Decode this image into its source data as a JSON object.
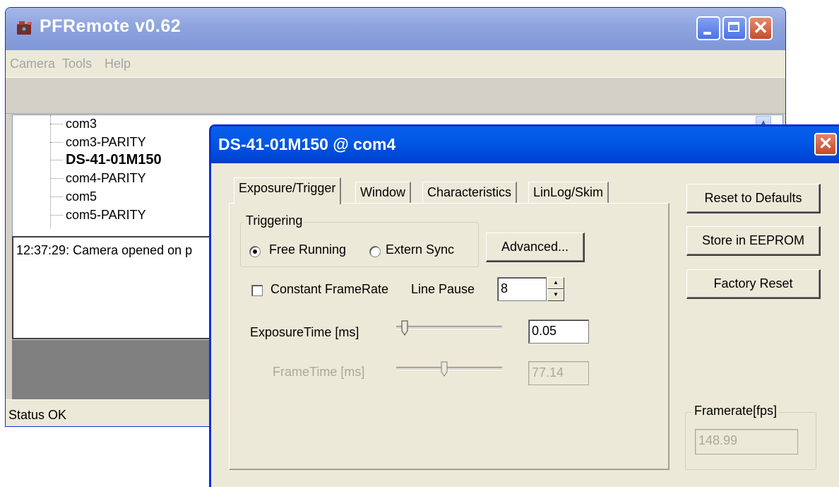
{
  "main_window": {
    "title": "PFRemote v0.62",
    "menu": [
      "Camera",
      "Tools",
      "Help"
    ],
    "tree_items": [
      {
        "label": "com3",
        "selected": false
      },
      {
        "label": "com3-PARITY",
        "selected": false
      },
      {
        "label": "DS-41-01M150",
        "selected": true
      },
      {
        "label": "com4-PARITY",
        "selected": false
      },
      {
        "label": "com5",
        "selected": false
      },
      {
        "label": "com5-PARITY",
        "selected": false
      }
    ],
    "log_line": "12:37:29: Camera opened on p",
    "status": "Status OK"
  },
  "dialog": {
    "title": "DS-41-01M150 @ com4",
    "tabs": [
      "Exposure/Trigger",
      "Window",
      "Characteristics",
      "LinLog/Skim"
    ],
    "active_tab": "Exposure/Trigger",
    "triggering": {
      "legend": "Triggering",
      "options": [
        "Free Running",
        "Extern Sync"
      ],
      "selected": "Free Running",
      "advanced_button": "Advanced..."
    },
    "constant_framerate": {
      "label": "Constant FrameRate",
      "checked": false
    },
    "line_pause": {
      "label": "Line Pause",
      "value": "8"
    },
    "exposure_time": {
      "label": "ExposureTime [ms]",
      "value": "0.05",
      "slider_fraction": 0.05
    },
    "frame_time": {
      "label": "FrameTime [ms]",
      "value": "77.14",
      "slider_fraction": 0.45,
      "enabled": false
    },
    "side_buttons": [
      "Reset to Defaults",
      "Store in EEPROM",
      "Factory Reset"
    ],
    "framerate": {
      "legend": "Framerate[fps]",
      "value": "148.99"
    }
  },
  "colors": {
    "dialog_titlebar": "#0058e6",
    "main_titlebar_inactive": "#8ea4df",
    "face": "#ece9d8",
    "disabled_text": "#aca899"
  }
}
